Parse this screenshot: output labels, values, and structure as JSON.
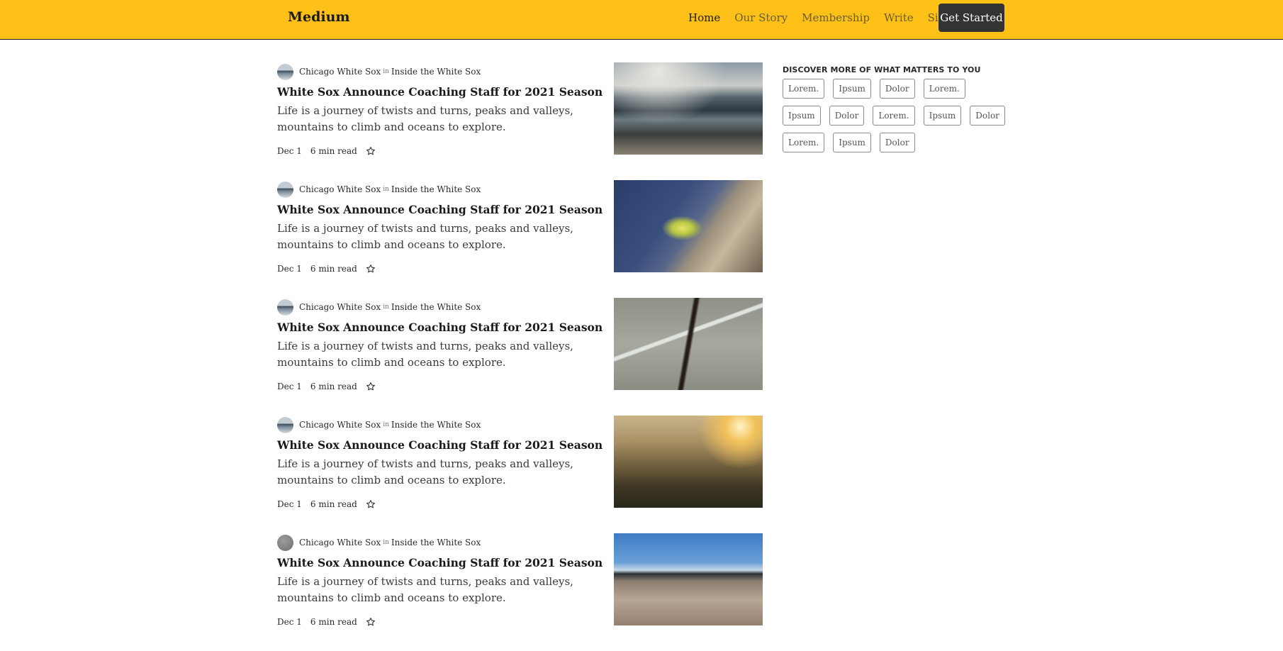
{
  "header": {
    "logo": "Medium",
    "nav": [
      "Home",
      "Our Story",
      "Membership",
      "Write",
      "Sign In"
    ],
    "active_nav": "Home",
    "cta": "Get Started",
    "background_color": "#ffc017"
  },
  "posts": [
    {
      "author": "Chicago White Sox",
      "in": "in",
      "publication": "Inside the White Sox",
      "title": "White Sox Announce Coaching Staff for 2021 Season",
      "excerpt": "Life is a journey of twists and turns, peaks and valleys, mountains to climb and oceans to explore.",
      "date": "Dec 1",
      "read_time": "6 min read",
      "image": "ocean-beach-photo"
    },
    {
      "author": "Chicago White Sox",
      "in": "in",
      "publication": "Inside the White Sox",
      "title": "White Sox Announce Coaching Staff for 2021 Season",
      "excerpt": "Life is a journey of twists and turns, peaks and valleys, mountains to climb and oceans to explore.",
      "date": "Dec 1",
      "read_time": "6 min read",
      "image": "plant-on-rock-photo"
    },
    {
      "author": "Chicago White Sox",
      "in": "in",
      "publication": "Inside the White Sox",
      "title": "White Sox Announce Coaching Staff for 2021 Season",
      "excerpt": "Life is a journey of twists and turns, peaks and valleys, mountains to climb and oceans to explore.",
      "date": "Dec 1",
      "read_time": "6 min read",
      "image": "man-walking-road-photo"
    },
    {
      "author": "Chicago White Sox",
      "in": "in",
      "publication": "Inside the White Sox",
      "title": "White Sox Announce Coaching Staff for 2021 Season",
      "excerpt": "Life is a journey of twists and turns, peaks and valleys, mountains to climb and oceans to explore.",
      "date": "Dec 1",
      "read_time": "6 min read",
      "image": "forest-sunset-photo"
    },
    {
      "author": "Chicago White Sox",
      "in": "in",
      "publication": "Inside the White Sox",
      "title": "White Sox Announce Coaching Staff for 2021 Season",
      "excerpt": "Life is a journey of twists and turns, peaks and valleys, mountains to climb and oceans to explore.",
      "date": "Dec 1",
      "read_time": "6 min read",
      "image": "wooden-deck-sky-photo"
    }
  ],
  "sidebar": {
    "heading": "DISCOVER MORE OF WHAT MATTERS TO YOU",
    "tags": [
      "Lorem.",
      "Ipsum",
      "Dolor",
      "Lorem.",
      "Ipsum",
      "Dolor",
      "Lorem.",
      "Ipsum",
      "Dolor",
      "Lorem.",
      "Ipsum",
      "Dolor"
    ]
  }
}
